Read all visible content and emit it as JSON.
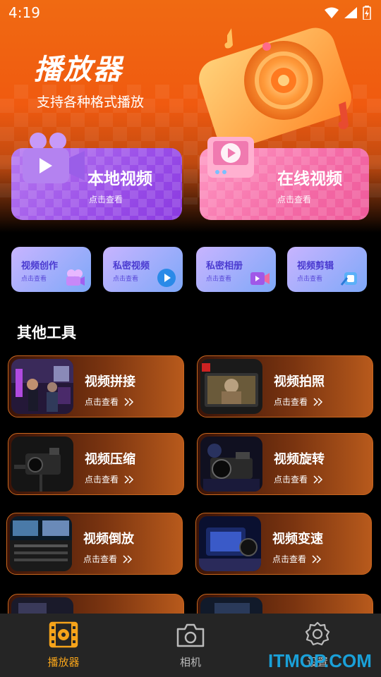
{
  "status": {
    "time": "4:19"
  },
  "hero": {
    "title": "播放器",
    "subtitle": "支持各种格式播放"
  },
  "main_cards": [
    {
      "title": "本地视频",
      "sub": "点击查看"
    },
    {
      "title": "在线视频",
      "sub": "点击查看"
    }
  ],
  "small_cards": [
    {
      "title": "视频创作",
      "sub": "点击查看"
    },
    {
      "title": "私密视频",
      "sub": "点击查看"
    },
    {
      "title": "私密相册",
      "sub": "点击查看"
    },
    {
      "title": "视频剪辑",
      "sub": "点击查看"
    }
  ],
  "section": {
    "title": "其他工具"
  },
  "tools": [
    {
      "name": "视频拼接",
      "link": "点击查看"
    },
    {
      "name": "视频拍照",
      "link": "点击查看"
    },
    {
      "name": "视频压缩",
      "link": "点击查看"
    },
    {
      "name": "视频旋转",
      "link": "点击查看"
    },
    {
      "name": "视频倒放",
      "link": "点击查看"
    },
    {
      "name": "视频变速",
      "link": "点击查看"
    }
  ],
  "nav": [
    {
      "label": "播放器",
      "active": true
    },
    {
      "label": "相机",
      "active": false
    },
    {
      "label": "设置",
      "active": false
    }
  ],
  "watermark": "ITMOP.COM",
  "colors": {
    "accent": "#f5a31a",
    "hero_orange": "#f06a12",
    "local_purple": "#9a4ee8",
    "online_pink": "#f46aa6",
    "nav_bg": "#252525"
  }
}
